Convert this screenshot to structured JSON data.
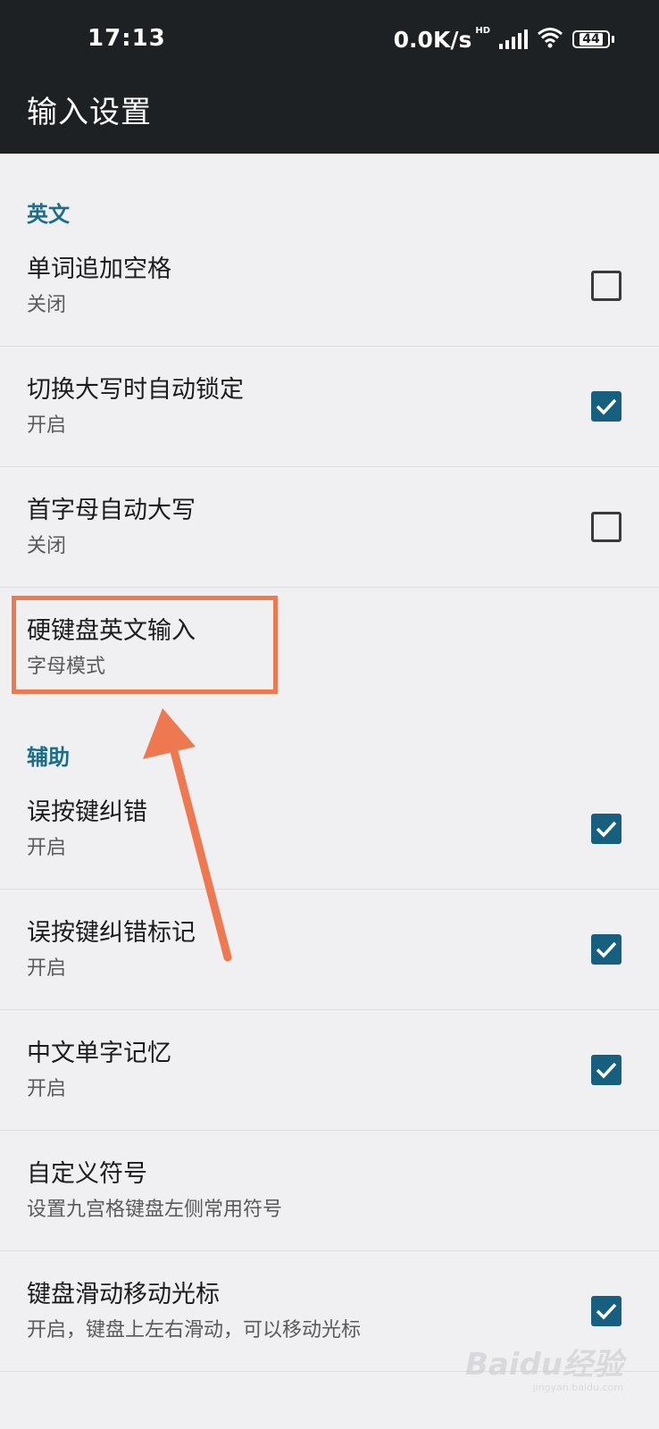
{
  "status_bar": {
    "time": "17:13",
    "net_speed": "0.0K/s",
    "hd_label": "HD",
    "battery": "44"
  },
  "app_bar": {
    "title": "输入设置"
  },
  "sections": {
    "english": {
      "header": "英文"
    },
    "assist": {
      "header": "辅助"
    }
  },
  "rows": [
    {
      "title": "单词追加空格",
      "subtitle": "关闭",
      "checked": false
    },
    {
      "title": "切换大写时自动锁定",
      "subtitle": "开启",
      "checked": true
    },
    {
      "title": "首字母自动大写",
      "subtitle": "关闭",
      "checked": false
    },
    {
      "title": "硬键盘英文输入",
      "subtitle": "字母模式"
    },
    {
      "title": "误按键纠错",
      "subtitle": "开启",
      "checked": true
    },
    {
      "title": "误按键纠错标记",
      "subtitle": "开启",
      "checked": true
    },
    {
      "title": "中文单字记忆",
      "subtitle": "开启",
      "checked": true
    },
    {
      "title": "自定义符号",
      "subtitle": "设置九宫格键盘左侧常用符号"
    },
    {
      "title": "键盘滑动移动光标",
      "subtitle": "开启，键盘上左右滑动，可以移动光标",
      "checked": true
    }
  ],
  "watermark": {
    "brand": "Baidu经验",
    "url": "jingyan.baidu.com"
  },
  "colors": {
    "accent": "#175f7e",
    "annotation": "#ee7850",
    "app_bar": "#1e2124"
  }
}
